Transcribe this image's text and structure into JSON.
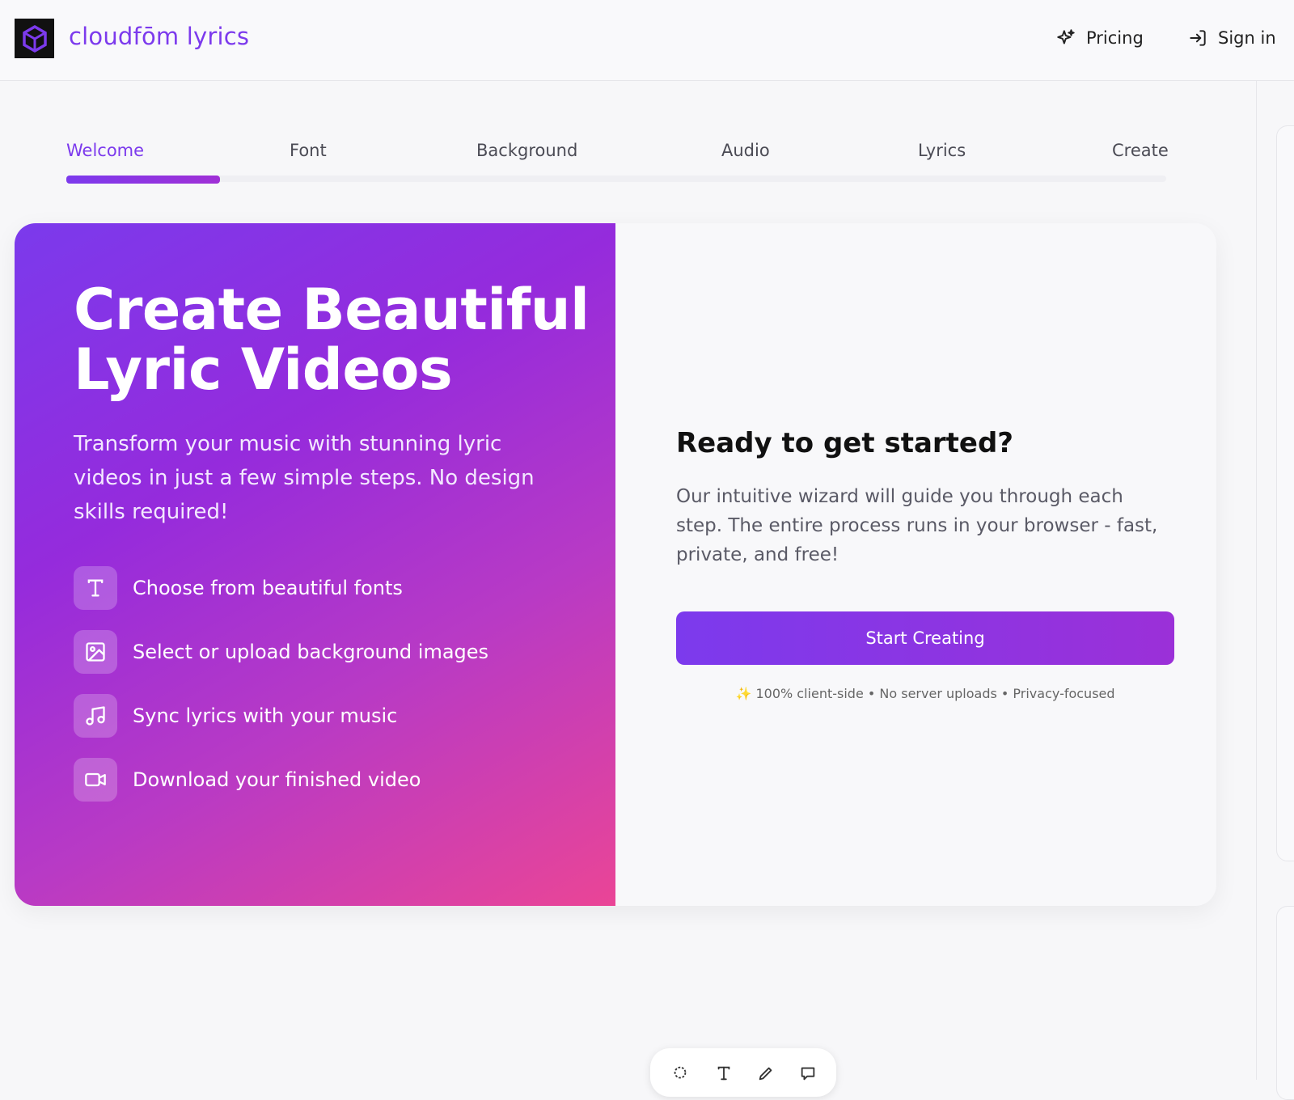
{
  "header": {
    "brand": "cloudfōm lyrics",
    "nav": {
      "pricing": "Pricing",
      "signin": "Sign in"
    }
  },
  "wizard": {
    "steps": [
      "Welcome",
      "Font",
      "Background",
      "Audio",
      "Lyrics",
      "Create"
    ],
    "active_step": "Welcome",
    "progress": 0.14
  },
  "hero": {
    "title_line1": "Create Beautiful",
    "title_line2": "Lyric Videos",
    "subtitle": "Transform your music with stunning lyric videos in just a few simple steps. No design skills required!",
    "features": [
      {
        "icon": "type-icon",
        "label": "Choose from beautiful fonts"
      },
      {
        "icon": "image-icon",
        "label": "Select or upload background images"
      },
      {
        "icon": "music-icon",
        "label": "Sync lyrics with your music"
      },
      {
        "icon": "video-icon",
        "label": "Download your finished video"
      }
    ]
  },
  "panel": {
    "title": "Ready to get started?",
    "description": "Our intuitive wizard will guide you through each step. The entire process runs in your browser - fast, private, and free!",
    "cta": "Start Creating",
    "note": "✨ 100% client-side • No server uploads • Privacy-focused"
  },
  "toolbar": {
    "tools": [
      "lasso-icon",
      "text-icon",
      "pencil-icon",
      "comment-icon"
    ]
  },
  "colors": {
    "accent": "#7c3aed",
    "gradient_start": "#7b3aec",
    "gradient_end": "#ea4596"
  }
}
